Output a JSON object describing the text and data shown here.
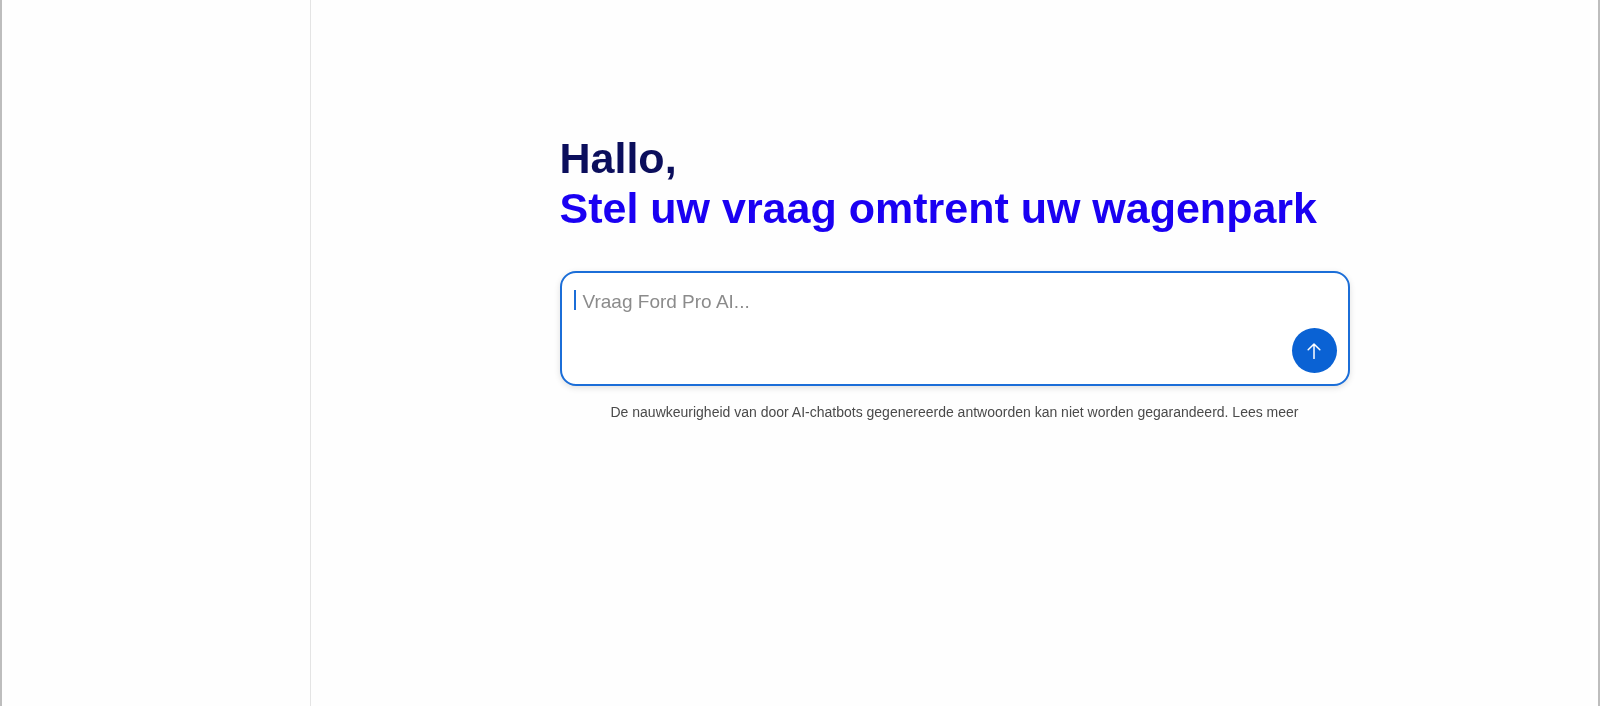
{
  "greeting": {
    "line_1": "Hallo,",
    "line_2": "Stel uw vraag omtrent uw wagenpark"
  },
  "chat_input": {
    "placeholder": "Vraag Ford Pro AI...",
    "focused": true
  },
  "disclaimer": {
    "text": "De nauwkeurigheid van door AI-chatbots gegenereerde antwoorden kan niet worden gegarandeerd.",
    "link": "Lees meer"
  }
}
